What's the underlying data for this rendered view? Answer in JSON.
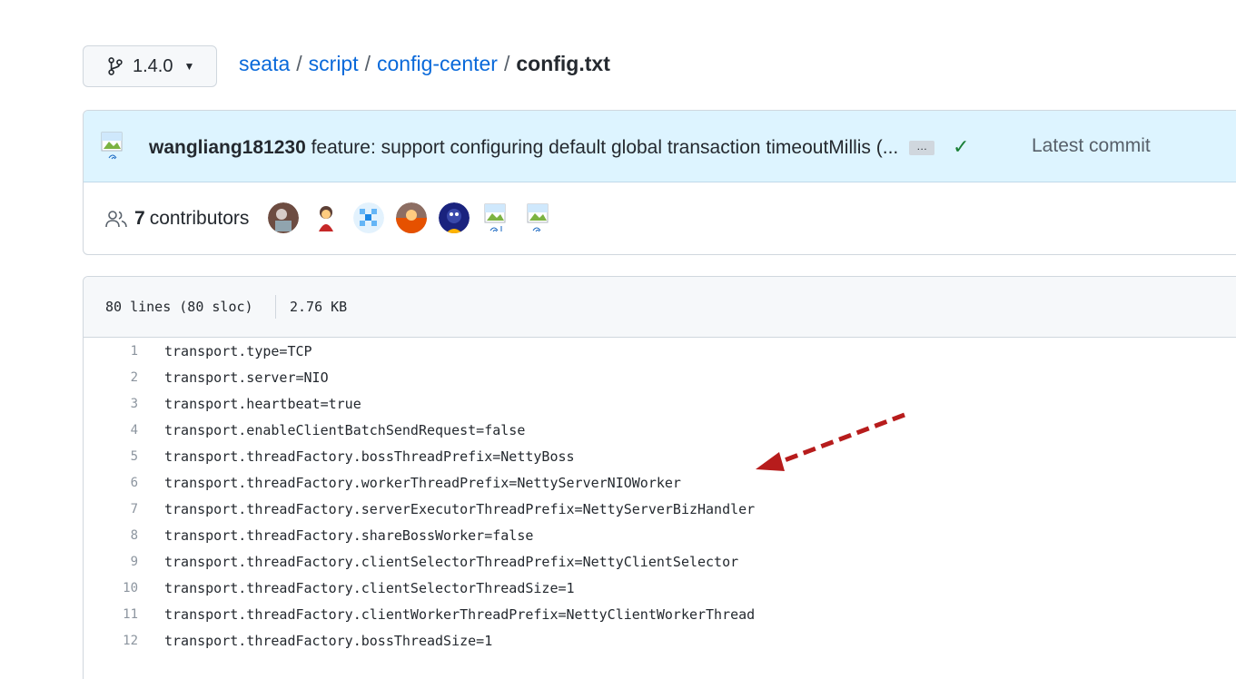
{
  "branch": {
    "name": "1.4.0",
    "icon": "git-branch-icon"
  },
  "breadcrumb": {
    "repo": "seata",
    "sep1": "/",
    "dir1": "script",
    "sep2": "/",
    "dir2": "config-center",
    "sep3": "/",
    "file": "config.txt"
  },
  "commit": {
    "author": "wangliang181230",
    "message": "feature: support configuring default global transaction timeoutMillis (...",
    "ellipsis": "…",
    "status_icon": "check-icon",
    "status_color": "#1a7f37",
    "latest_label": "Latest commit"
  },
  "contributors": {
    "count": "7",
    "label": "contributors",
    "avatar_colors": [
      "#6d4c41",
      "#c62828",
      "#90caf9",
      "#8d6e63",
      "#3949ab"
    ]
  },
  "file_info": {
    "lines": "80 lines (80 sloc)",
    "size": "2.76 KB"
  },
  "code_lines": [
    {
      "n": "1",
      "text": "transport.type=TCP"
    },
    {
      "n": "2",
      "text": "transport.server=NIO"
    },
    {
      "n": "3",
      "text": "transport.heartbeat=true"
    },
    {
      "n": "4",
      "text": "transport.enableClientBatchSendRequest=false"
    },
    {
      "n": "5",
      "text": "transport.threadFactory.bossThreadPrefix=NettyBoss"
    },
    {
      "n": "6",
      "text": "transport.threadFactory.workerThreadPrefix=NettyServerNIOWorker"
    },
    {
      "n": "7",
      "text": "transport.threadFactory.serverExecutorThreadPrefix=NettyServerBizHandler"
    },
    {
      "n": "8",
      "text": "transport.threadFactory.shareBossWorker=false"
    },
    {
      "n": "9",
      "text": "transport.threadFactory.clientSelectorThreadPrefix=NettyClientSelector"
    },
    {
      "n": "10",
      "text": "transport.threadFactory.clientSelectorThreadSize=1"
    },
    {
      "n": "11",
      "text": "transport.threadFactory.clientWorkerThreadPrefix=NettyClientWorkerThread"
    },
    {
      "n": "12",
      "text": "transport.threadFactory.bossThreadSize=1"
    }
  ],
  "annotation": {
    "arrow_color": "#b71c1c"
  }
}
